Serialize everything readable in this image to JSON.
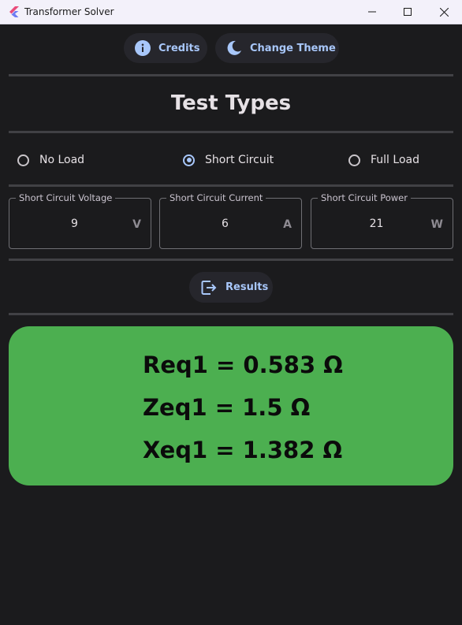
{
  "window": {
    "title": "Transformer Solver",
    "minimize_icon": "minimize-icon",
    "maximize_icon": "maximize-icon",
    "close_icon": "close-icon"
  },
  "toolbar": {
    "credits_label": "Credits",
    "credits_icon": "info-icon",
    "theme_label": "Change Theme",
    "theme_icon": "moon-icon"
  },
  "section_title": "Test Types",
  "test_types": {
    "options": [
      "No Load",
      "Short Circuit",
      "Full Load"
    ],
    "selected": "Short Circuit"
  },
  "inputs": [
    {
      "label": "Short Circuit Voltage",
      "value": "9",
      "unit": "V"
    },
    {
      "label": "Short Circuit Current",
      "value": "6",
      "unit": "A"
    },
    {
      "label": "Short Circuit Power",
      "value": "21",
      "unit": "W"
    }
  ],
  "results_button": {
    "label": "Results",
    "icon": "output-icon"
  },
  "results": [
    "Req1 = 0.583 Ω",
    "Zeq1 = 1.5 Ω",
    "Xeq1 = 1.382 Ω"
  ],
  "colors": {
    "background": "#1b1b1d",
    "accent": "#a8c7fa",
    "result_card": "#4caf50",
    "divider": "#414145"
  }
}
